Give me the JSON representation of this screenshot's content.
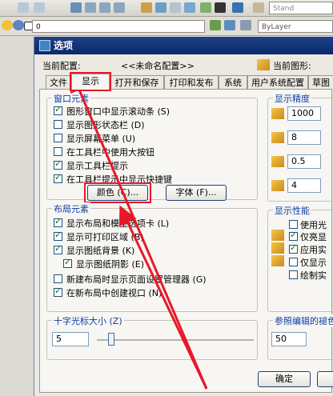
{
  "toolbar": {
    "std_label": "Stand",
    "layer_combo": "0",
    "bylayer_combo": "ByLayer"
  },
  "dialog": {
    "title": "选项",
    "current_profile_label": "当前配置:",
    "current_profile_value": "<<未命名配置>>",
    "current_drawing_label": "当前图形:",
    "tabs": [
      {
        "label": "文件"
      },
      {
        "label": "显示"
      },
      {
        "label": "打开和保存"
      },
      {
        "label": "打印和发布"
      },
      {
        "label": "系统"
      },
      {
        "label": "用户系统配置"
      },
      {
        "label": "草图"
      }
    ],
    "window_elements": {
      "title": "窗口元素",
      "items": [
        {
          "label": "图形窗口中显示滚动条 (S)",
          "checked": true
        },
        {
          "label": "显示图形状态栏 (D)",
          "checked": false
        },
        {
          "label": "显示屏幕菜单 (U)",
          "checked": false
        },
        {
          "label": "在工具栏中使用大按钮",
          "checked": false
        },
        {
          "label": "显示工具栏提示",
          "checked": true
        },
        {
          "label": "在工具栏提示中显示快捷键",
          "checked": true
        }
      ],
      "color_button": "颜色 (C)...",
      "font_button": "字体 (F)..."
    },
    "layout_elements": {
      "title": "布局元素",
      "items": [
        {
          "label": "显示布局和模型选项卡 (L)",
          "checked": true
        },
        {
          "label": "显示可打印区域 (B)",
          "checked": true
        },
        {
          "label": "显示图纸背景 (K)",
          "checked": true
        },
        {
          "label": "显示图纸阴影 (E)",
          "checked": true
        },
        {
          "label": "新建布局时显示页面设置管理器 (G)",
          "checked": false
        },
        {
          "label": "在新布局中创建视口 (N)",
          "checked": true
        }
      ]
    },
    "crosshair": {
      "title": "十字光标大小 (Z)",
      "value": "5"
    },
    "display_resolution": {
      "title": "显示精度",
      "values": [
        "1000",
        "8",
        "0.5",
        "4"
      ]
    },
    "display_performance": {
      "title": "显示性能",
      "items": [
        {
          "label": "使用光",
          "checked": false
        },
        {
          "label": "仅亮显",
          "checked": true
        },
        {
          "label": "应用实",
          "checked": true
        },
        {
          "label": "仅显示",
          "checked": false
        },
        {
          "label": "绘制实",
          "checked": false
        }
      ]
    },
    "reference_edit": {
      "title": "参照编辑的褪色",
      "value": "50"
    },
    "ok_button": "确定"
  },
  "colors": {
    "highlight_red": "#e8182a",
    "title_blue": "#0b3ea3",
    "titlebar": "#0b2a6b"
  }
}
